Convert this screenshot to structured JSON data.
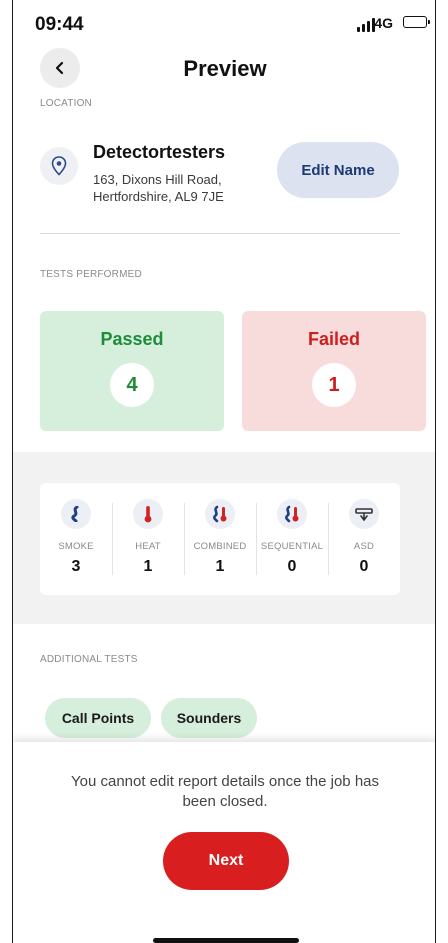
{
  "status_bar": {
    "time": "09:44",
    "network": "4G",
    "battery_level": 0.6
  },
  "header": {
    "title": "Preview",
    "back_icon": "chevron-left-icon"
  },
  "location": {
    "section_label": "LOCATION",
    "name": "Detectortesters",
    "address_line1": "163, Dixons Hill Road,",
    "address_line2": "Hertfordshire, AL9 7JE",
    "edit_button_label": "Edit Name"
  },
  "tests": {
    "section_label": "TESTS PERFORMED",
    "passed": {
      "label": "Passed",
      "count": "4",
      "color": "#1e8c3a"
    },
    "failed": {
      "label": "Failed",
      "count": "1",
      "color": "#cc1f1f"
    },
    "types": [
      {
        "label": "SMOKE",
        "value": "3",
        "icon": "smoke-icon"
      },
      {
        "label": "HEAT",
        "value": "1",
        "icon": "thermometer-icon"
      },
      {
        "label": "COMBINED",
        "value": "1",
        "icon": "combined-icon"
      },
      {
        "label": "SEQUENTIAL",
        "value": "0",
        "icon": "sequential-icon"
      },
      {
        "label": "ASD",
        "value": "0",
        "icon": "asd-icon"
      }
    ]
  },
  "additional": {
    "section_label": "ADDITIONAL TESTS",
    "chips": [
      "Call Points",
      "Sounders"
    ]
  },
  "footer": {
    "notice": "You cannot edit report details once the job has been closed.",
    "next_label": "Next",
    "accent": "#d81e1e"
  }
}
